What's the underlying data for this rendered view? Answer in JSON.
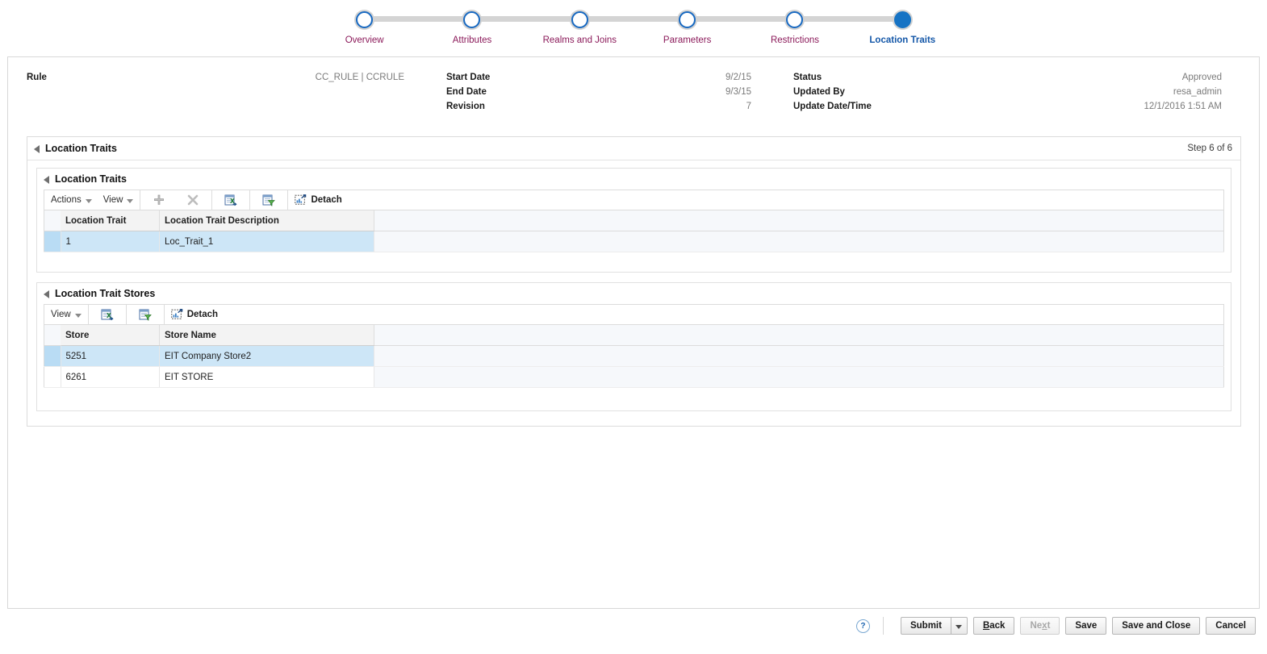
{
  "train": {
    "steps": [
      {
        "label": "Overview",
        "state": "visited"
      },
      {
        "label": "Attributes",
        "state": "visited"
      },
      {
        "label": "Realms and Joins",
        "state": "visited"
      },
      {
        "label": "Parameters",
        "state": "visited"
      },
      {
        "label": "Restrictions",
        "state": "visited"
      },
      {
        "label": "Location Traits",
        "state": "current"
      }
    ],
    "accent_current": "#1673c4",
    "accent_label": "#8b1a5a"
  },
  "rule_header": {
    "col1": [
      {
        "label": "Rule",
        "value": "CC_RULE | CCRULE"
      }
    ],
    "col2": [
      {
        "label": "Start Date",
        "value": "9/2/15"
      },
      {
        "label": "End Date",
        "value": "9/3/15"
      },
      {
        "label": "Revision",
        "value": "7"
      }
    ],
    "col3": [
      {
        "label": "Status",
        "value": "Approved"
      },
      {
        "label": "Updated By",
        "value": "resa_admin"
      },
      {
        "label": "Update Date/Time",
        "value": "12/1/2016 1:51 AM"
      }
    ]
  },
  "main_panel": {
    "title": "Location Traits",
    "step_indicator": "Step 6 of 6"
  },
  "traits_panel": {
    "title": "Location Traits",
    "toolbar": {
      "actions_label": "Actions",
      "view_label": "View",
      "add_icon": "plus-icon",
      "delete_icon": "delete-x-icon",
      "export_icon": "export-to-excel-icon",
      "query_icon": "query-by-example-icon",
      "detach_label": "Detach",
      "detach_icon": "detach-icon"
    },
    "columns": [
      "Location Trait",
      "Location Trait Description"
    ],
    "rows": [
      {
        "cells": [
          "1",
          "Loc_Trait_1"
        ],
        "selected": true
      }
    ]
  },
  "stores_panel": {
    "title": "Location Trait Stores",
    "toolbar": {
      "view_label": "View",
      "export_icon": "export-to-excel-icon",
      "query_icon": "query-by-example-icon",
      "detach_label": "Detach",
      "detach_icon": "detach-icon"
    },
    "columns": [
      "Store",
      "Store Name"
    ],
    "rows": [
      {
        "cells": [
          "5251",
          "EIT Company Store2"
        ],
        "selected": true
      },
      {
        "cells": [
          "6261",
          "EIT STORE"
        ],
        "selected": false
      }
    ]
  },
  "footer": {
    "help_icon": "help-question-icon",
    "help_glyph": "?",
    "buttons": [
      {
        "name": "submit",
        "label": "Submit",
        "split": true,
        "disabled": false
      },
      {
        "name": "back",
        "label": "Back",
        "mnemonic": "B",
        "disabled": false
      },
      {
        "name": "next",
        "label": "Next",
        "mnemonic": "x",
        "disabled": true
      },
      {
        "name": "save",
        "label": "Save",
        "disabled": false
      },
      {
        "name": "save-and-close",
        "label": "Save and Close",
        "disabled": false
      },
      {
        "name": "cancel",
        "label": "Cancel",
        "disabled": false
      }
    ]
  }
}
